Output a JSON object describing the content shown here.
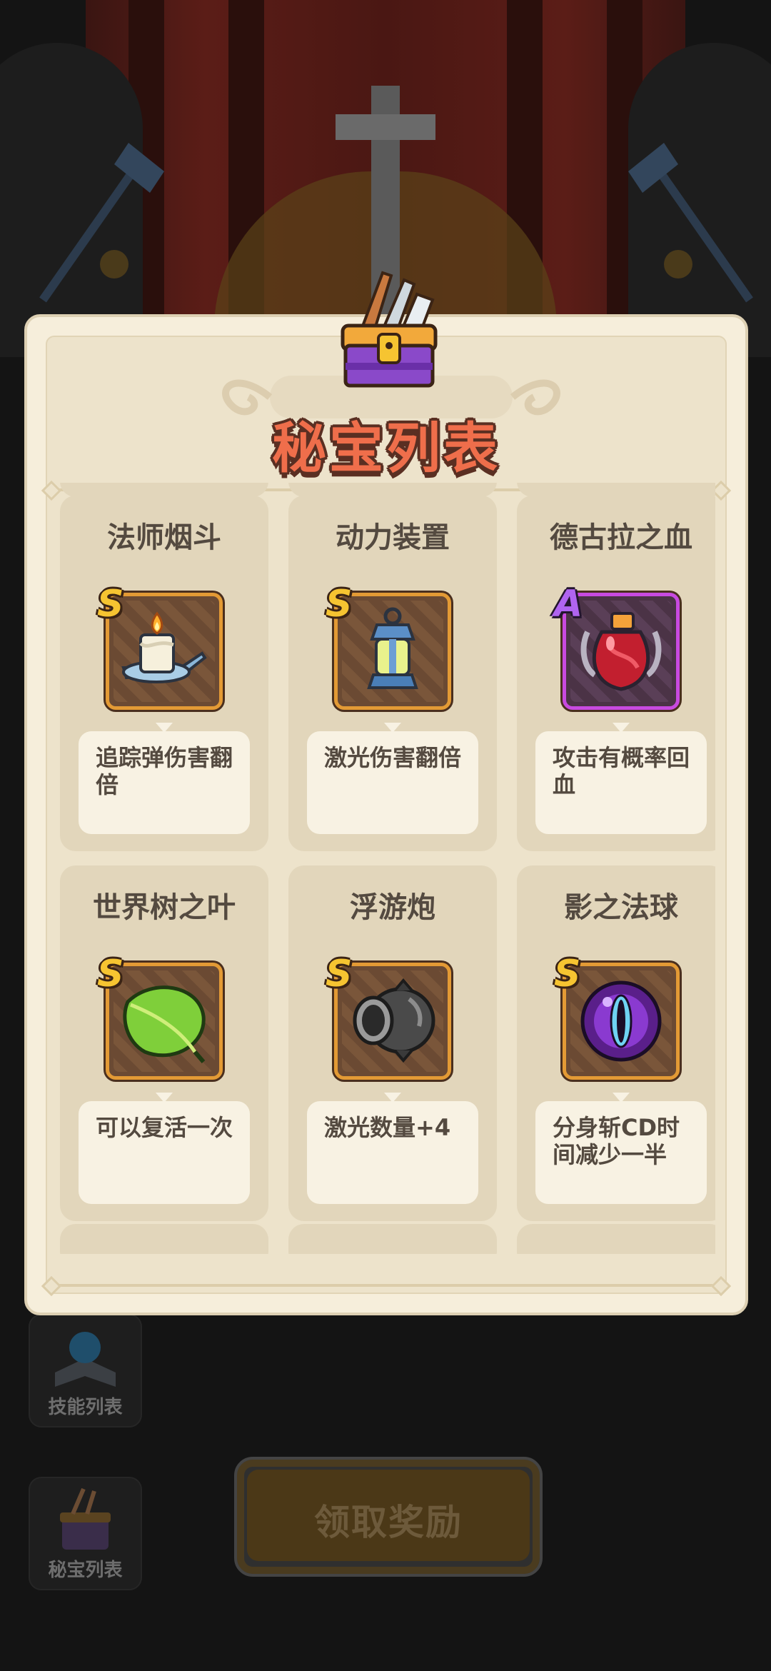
{
  "panel": {
    "title": "秘宝列表"
  },
  "treasures": [
    {
      "name": "法师烟斗",
      "rank": "S",
      "desc": "追踪弹伤害翻倍",
      "icon": "candle-icon"
    },
    {
      "name": "动力装置",
      "rank": "S",
      "desc": "激光伤害翻倍",
      "icon": "lantern-icon"
    },
    {
      "name": "德古拉之血",
      "rank": "A",
      "desc": "攻击有概率回血",
      "icon": "blood-potion-icon"
    },
    {
      "name": "世界树之叶",
      "rank": "S",
      "desc": "可以复活一次",
      "icon": "leaf-icon"
    },
    {
      "name": "浮游炮",
      "rank": "S",
      "desc": "激光数量+4",
      "icon": "cannon-icon"
    },
    {
      "name": "影之法球",
      "rank": "S",
      "desc": "分身斩CD时间减少一半",
      "icon": "shadow-orb-icon"
    }
  ],
  "side_menu": {
    "skills_label": "技能列表",
    "treasures_label": "秘宝列表"
  },
  "claim_button": {
    "label": "领取奖励"
  },
  "colors": {
    "title": "#ef6e4b",
    "rank_s": "#f6c431",
    "rank_a": "#b064f0",
    "panel_bg": "#f6eedb",
    "card_bg": "#e2d6bb"
  }
}
